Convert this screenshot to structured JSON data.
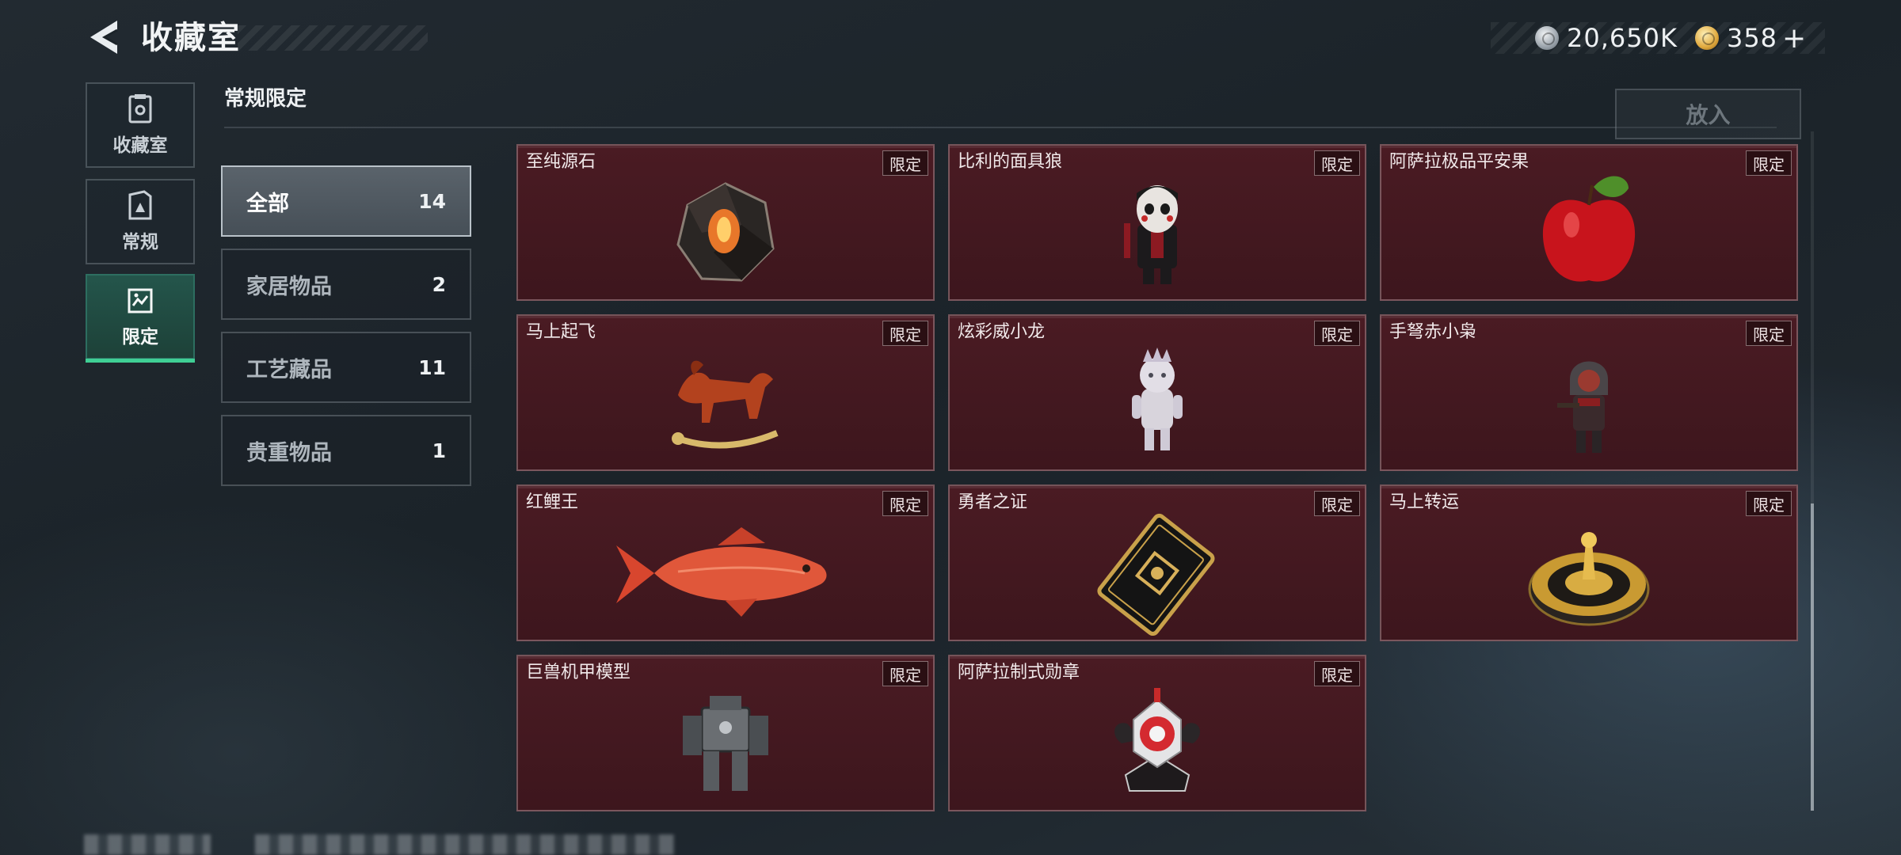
{
  "header": {
    "title": "收藏室",
    "currency": [
      {
        "icon": "silver-coin-icon",
        "value": "20,650K"
      },
      {
        "icon": "gold-coin-icon",
        "value": "358"
      }
    ],
    "plus_label": "+"
  },
  "nav": {
    "items": [
      {
        "label": "收藏室",
        "icon": "collection-icon"
      },
      {
        "label": "常规",
        "icon": "regular-icon"
      },
      {
        "label": "限定",
        "icon": "limited-icon",
        "active": true
      }
    ]
  },
  "section": {
    "title": "常规限定",
    "put_in_label": "放入"
  },
  "categories": [
    {
      "label": "全部",
      "count": "14",
      "active": true
    },
    {
      "label": "家居物品",
      "count": "2"
    },
    {
      "label": "工艺藏品",
      "count": "11"
    },
    {
      "label": "贵重物品",
      "count": "1"
    }
  ],
  "items": [
    {
      "name": "至纯源石",
      "badge": "限定",
      "icon": "crystal-stone-icon"
    },
    {
      "name": "比利的面具狼",
      "badge": "限定",
      "icon": "mask-doll-icon"
    },
    {
      "name": "阿萨拉极品平安果",
      "badge": "限定",
      "icon": "red-apple-icon"
    },
    {
      "name": "马上起飞",
      "badge": "限定",
      "icon": "rocking-horse-icon"
    },
    {
      "name": "炫彩威小龙",
      "badge": "限定",
      "icon": "dragon-figure-icon"
    },
    {
      "name": "手弩赤小枭",
      "badge": "限定",
      "icon": "hooded-figure-icon"
    },
    {
      "name": "红鲤王",
      "badge": "限定",
      "icon": "red-carp-icon"
    },
    {
      "name": "勇者之证",
      "badge": "限定",
      "icon": "golden-card-icon"
    },
    {
      "name": "马上转运",
      "badge": "限定",
      "icon": "fortune-wheel-icon"
    },
    {
      "name": "巨兽机甲模型",
      "badge": "限定",
      "icon": "mech-model-icon"
    },
    {
      "name": "阿萨拉制式勋章",
      "badge": "限定",
      "icon": "medal-icon"
    }
  ],
  "colors": {
    "accent_green": "#3fcf95",
    "card_bg": "#4a1b23",
    "background": "#1b2329"
  }
}
